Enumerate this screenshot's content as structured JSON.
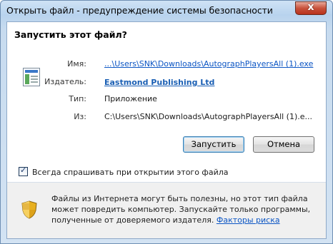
{
  "window": {
    "title": "Открыть файл - предупреждение системы безопасности",
    "close_symbol": "x"
  },
  "dialog": {
    "question": "Запустить этот файл?",
    "fields": {
      "name_label": "Имя:",
      "name_value": "...\\Users\\SNK\\Downloads\\AutographPlayersAll (1).exe",
      "publisher_label": "Издатель:",
      "publisher_value": "Eastmond Publishing Ltd",
      "type_label": "Тип:",
      "type_value": "Приложение",
      "from_label": "Из:",
      "from_value": "C:\\Users\\SNK\\Downloads\\AutographPlayersAll (1).e..."
    },
    "buttons": {
      "run": "Запустить",
      "cancel": "Отмена"
    },
    "checkbox": {
      "label": "Всегда спрашивать при открытии этого файла",
      "checked": true,
      "check_glyph": "✓"
    },
    "warning": {
      "text": "Файлы из Интернета могут быть полезны, но этот тип файла может повредить компьютер. Запускайте только программы, полученные от доверяемого издателя.",
      "link": "Факторы риска"
    }
  },
  "icons": {
    "file": "application-file-icon",
    "shield": "security-shield-icon"
  }
}
